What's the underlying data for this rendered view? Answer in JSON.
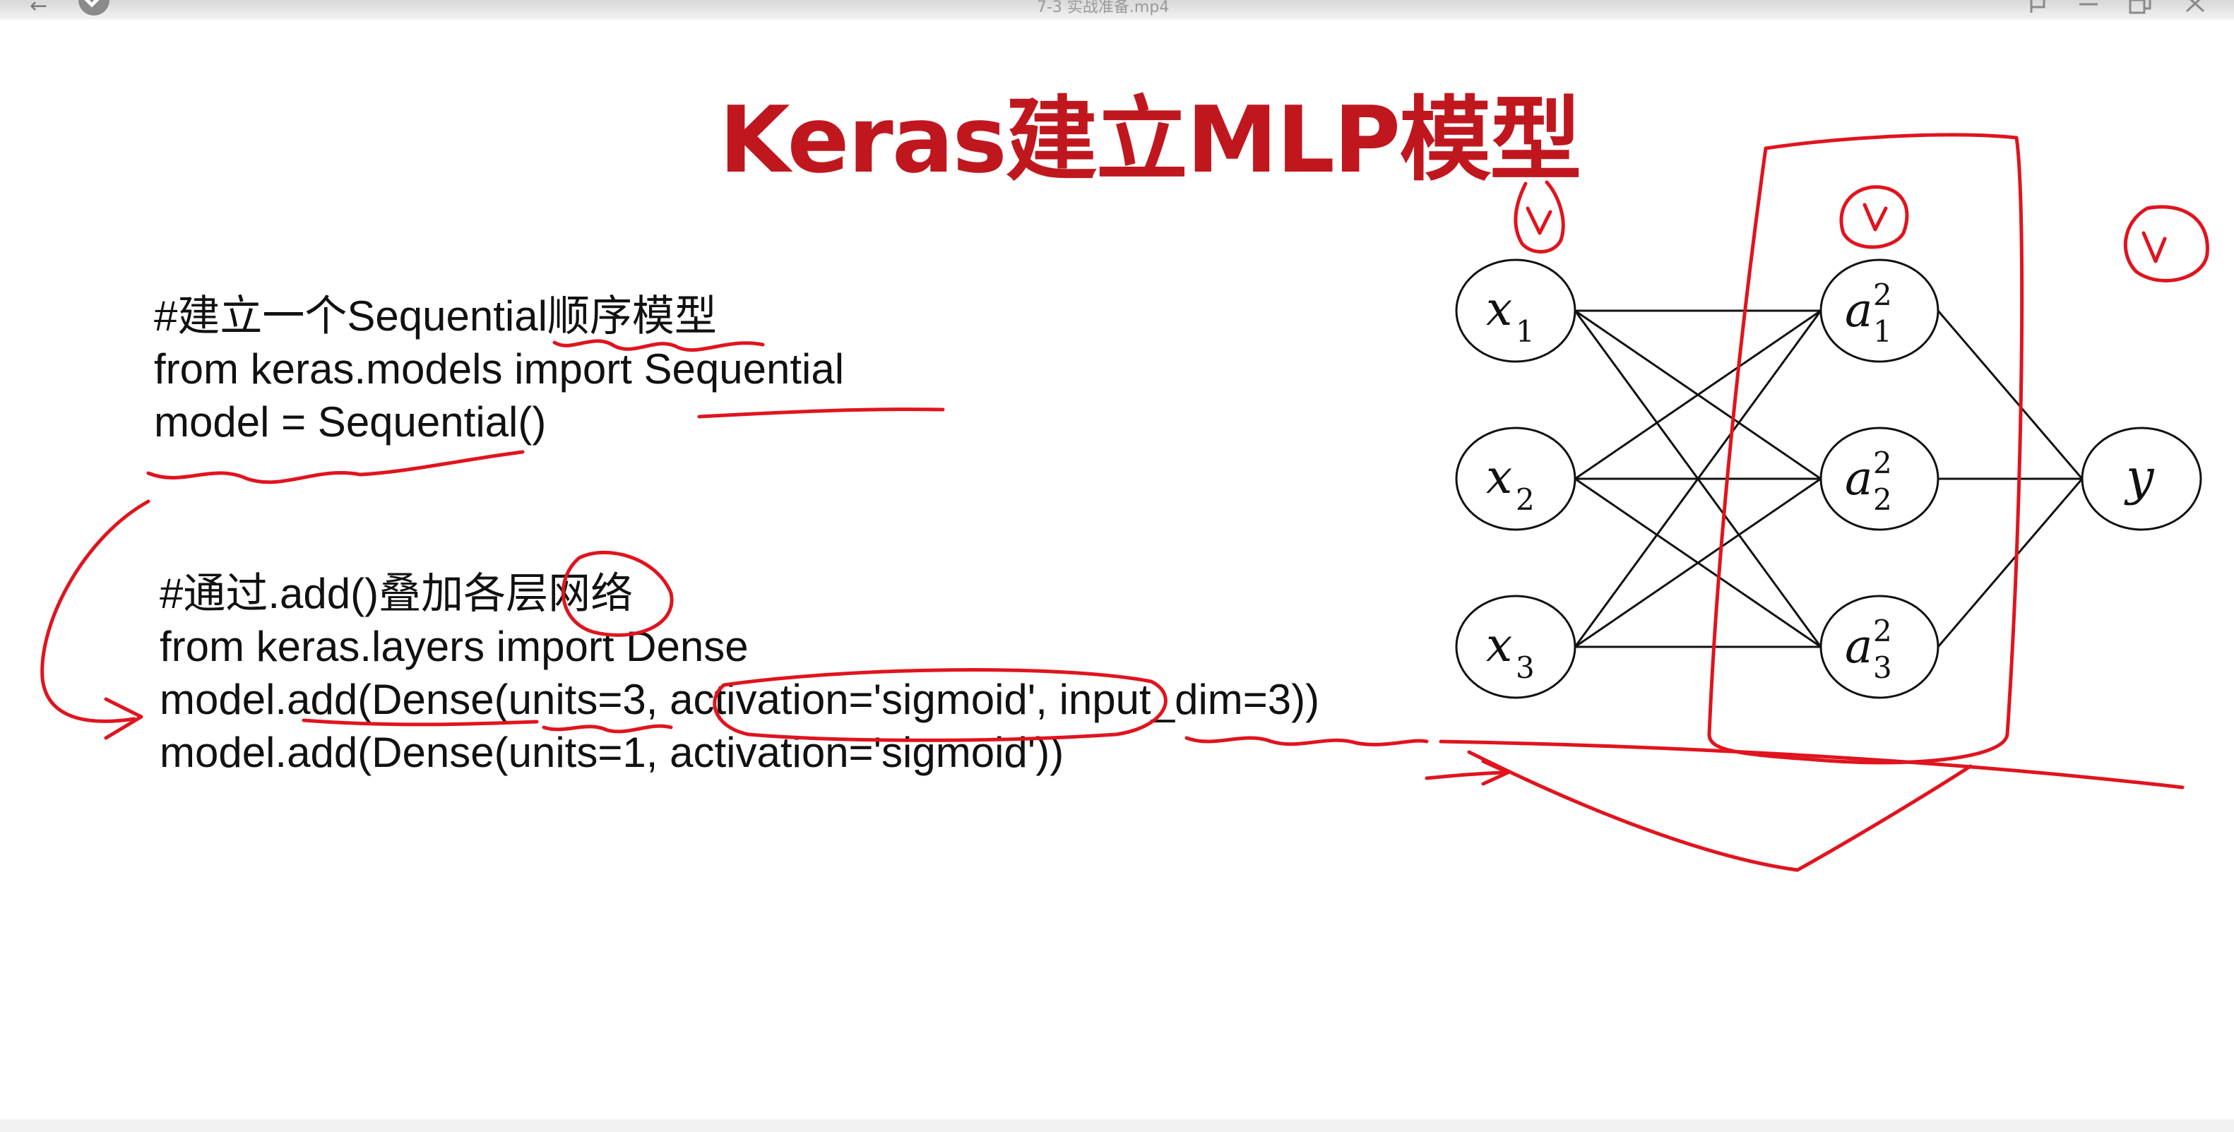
{
  "window": {
    "filename": "7-3 实战准备.mp4",
    "back_icon": "arrow-left-icon",
    "check_icon": "check-icon",
    "pin_icon": "pin-icon",
    "minimize_icon": "minimize-icon",
    "restore_icon": "restore-icon",
    "close_icon": "close-icon"
  },
  "slide": {
    "title": "Keras建立MLP模型",
    "title_color": "#c0171f",
    "ink_color": "#e0141e",
    "code": {
      "comment1": "#建立一个Sequential顺序模型",
      "line1": "from keras.models import Sequential",
      "line2": "model = Sequential()",
      "comment2": "#通过.add()叠加各层网络",
      "line3": "from keras.layers import Dense",
      "line4": "model.add(Dense(units=3, activation='sigmoid', input_dim=3))",
      "line5": "model.add(Dense(units=1, activation='sigmoid'))"
    }
  },
  "network": {
    "inputs": [
      {
        "base": "x",
        "sub": "1",
        "sup": ""
      },
      {
        "base": "x",
        "sub": "2",
        "sup": ""
      },
      {
        "base": "x",
        "sub": "3",
        "sup": ""
      }
    ],
    "hidden": [
      {
        "base": "a",
        "sub": "1",
        "sup": "2"
      },
      {
        "base": "a",
        "sub": "2",
        "sup": "2"
      },
      {
        "base": "a",
        "sub": "3",
        "sup": "2"
      }
    ],
    "output": {
      "base": "y",
      "sub": "",
      "sup": ""
    }
  }
}
